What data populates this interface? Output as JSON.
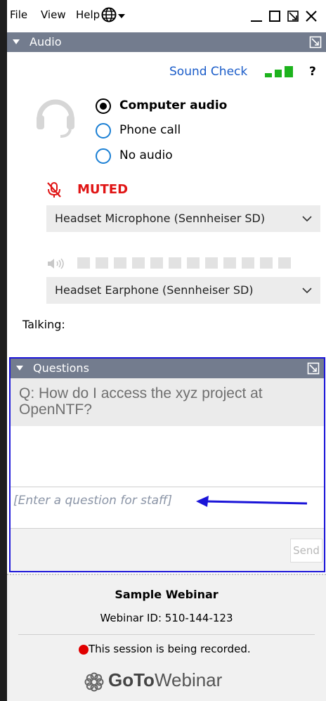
{
  "menu": {
    "file": "File",
    "view": "View",
    "help": "Help",
    "language_icon": "globe-icon"
  },
  "window_controls": [
    "minimize-icon",
    "restore-icon",
    "popout-icon",
    "close-icon"
  ],
  "audio": {
    "section_title": "Audio",
    "sound_check": "Sound Check",
    "help_mark": "?",
    "options": [
      {
        "label": "Computer audio",
        "selected": true
      },
      {
        "label": "Phone call",
        "selected": false
      },
      {
        "label": "No audio",
        "selected": false
      }
    ],
    "muted_label": "MUTED",
    "microphone": "Headset Microphone (Sennheiser SD)",
    "speaker": "Headset Earphone (Sennheiser SD)",
    "speaker_level_segments": 12,
    "talking_label": "Talking:",
    "colors": {
      "muted": "#e01414",
      "signal": "#1db31d",
      "link": "#1a5cc9"
    }
  },
  "questions": {
    "section_title": "Questions",
    "question_text": "Q: How do I access the xyz project at OpenNTF?",
    "input_placeholder": "[Enter a question for staff]",
    "send_label": "Send",
    "highlight_color": "#1a14d8"
  },
  "footer": {
    "webinar_title": "Sample Webinar",
    "webinar_id": "Webinar ID: 510-144-123",
    "recording_text": "This session is being recorded.",
    "brand_goto": "GoTo",
    "brand_webinar": "Webinar"
  }
}
